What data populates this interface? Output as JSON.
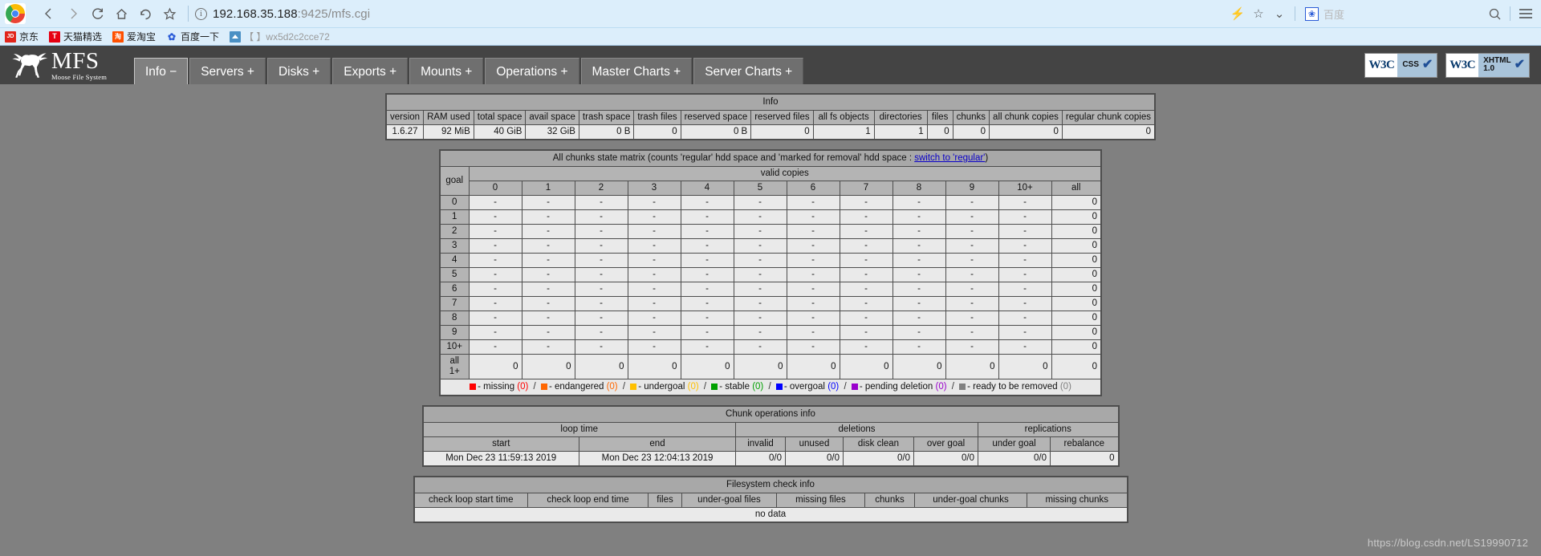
{
  "browser": {
    "url_host": "192.168.35.188",
    "url_rest": ":9425/mfs.cgi",
    "nav": {
      "back": "back-arrow",
      "forward": "forward-arrow",
      "reload": "reload",
      "home": "home",
      "history": "history-back",
      "bookmark": "star"
    },
    "right_icons": {
      "lightning": "⚡",
      "star": "☆",
      "chevron": "⌄",
      "search": "search-icon",
      "menu": "hamburger-menu"
    },
    "extension": {
      "label": "百度",
      "icon": "baidu-paw"
    },
    "bookmarks": [
      {
        "icon": "JD",
        "label": "京东",
        "type": "jd"
      },
      {
        "icon": "T",
        "label": "天猫精选",
        "type": "tm"
      },
      {
        "icon": "淘",
        "label": "爱淘宝",
        "type": "tao"
      },
      {
        "icon": "✿",
        "label": "百度一下",
        "type": "bd"
      },
      {
        "icon": "",
        "label": "【 】wx5d2c2cce72",
        "type": "home"
      }
    ]
  },
  "app": {
    "logo_main": "MFS",
    "logo_sub": "Moose File System",
    "tabs": [
      {
        "label": "Info −",
        "active": true
      },
      {
        "label": "Servers +",
        "active": false
      },
      {
        "label": "Disks +",
        "active": false
      },
      {
        "label": "Exports +",
        "active": false
      },
      {
        "label": "Mounts +",
        "active": false
      },
      {
        "label": "Operations +",
        "active": false
      },
      {
        "label": "Master Charts +",
        "active": false
      },
      {
        "label": "Server Charts +",
        "active": false
      }
    ],
    "badges": [
      {
        "brand": "W3C",
        "label": "CSS",
        "label2": ""
      },
      {
        "brand": "W3C",
        "label": "XHTML",
        "label2": "1.0"
      }
    ]
  },
  "info_table": {
    "title": "Info",
    "headers": [
      "version",
      "RAM used",
      "total space",
      "avail space",
      "trash space",
      "trash files",
      "reserved space",
      "reserved files",
      "all fs objects",
      "directories",
      "files",
      "chunks",
      "all chunk copies",
      "regular chunk copies"
    ],
    "row": [
      "1.6.27",
      "92 MiB",
      "40 GiB",
      "32 GiB",
      "0 B",
      "0",
      "0 B",
      "0",
      "1",
      "1",
      "0",
      "0",
      "0",
      "0"
    ]
  },
  "matrix": {
    "title_pre": "All chunks state matrix (counts 'regular' hdd space and 'marked for removal' hdd space : ",
    "title_link": "switch to 'regular'",
    "title_post": ")",
    "goal_label": "goal",
    "valid_copies_label": "valid copies",
    "columns": [
      "0",
      "1",
      "2",
      "3",
      "4",
      "5",
      "6",
      "7",
      "8",
      "9",
      "10+",
      "all"
    ],
    "rows": [
      {
        "goal": "0",
        "cells": [
          "-",
          "-",
          "-",
          "-",
          "-",
          "-",
          "-",
          "-",
          "-",
          "-",
          "-"
        ],
        "all": "0"
      },
      {
        "goal": "1",
        "cells": [
          "-",
          "-",
          "-",
          "-",
          "-",
          "-",
          "-",
          "-",
          "-",
          "-",
          "-"
        ],
        "all": "0"
      },
      {
        "goal": "2",
        "cells": [
          "-",
          "-",
          "-",
          "-",
          "-",
          "-",
          "-",
          "-",
          "-",
          "-",
          "-"
        ],
        "all": "0"
      },
      {
        "goal": "3",
        "cells": [
          "-",
          "-",
          "-",
          "-",
          "-",
          "-",
          "-",
          "-",
          "-",
          "-",
          "-"
        ],
        "all": "0"
      },
      {
        "goal": "4",
        "cells": [
          "-",
          "-",
          "-",
          "-",
          "-",
          "-",
          "-",
          "-",
          "-",
          "-",
          "-"
        ],
        "all": "0"
      },
      {
        "goal": "5",
        "cells": [
          "-",
          "-",
          "-",
          "-",
          "-",
          "-",
          "-",
          "-",
          "-",
          "-",
          "-"
        ],
        "all": "0"
      },
      {
        "goal": "6",
        "cells": [
          "-",
          "-",
          "-",
          "-",
          "-",
          "-",
          "-",
          "-",
          "-",
          "-",
          "-"
        ],
        "all": "0"
      },
      {
        "goal": "7",
        "cells": [
          "-",
          "-",
          "-",
          "-",
          "-",
          "-",
          "-",
          "-",
          "-",
          "-",
          "-"
        ],
        "all": "0"
      },
      {
        "goal": "8",
        "cells": [
          "-",
          "-",
          "-",
          "-",
          "-",
          "-",
          "-",
          "-",
          "-",
          "-",
          "-"
        ],
        "all": "0"
      },
      {
        "goal": "9",
        "cells": [
          "-",
          "-",
          "-",
          "-",
          "-",
          "-",
          "-",
          "-",
          "-",
          "-",
          "-"
        ],
        "all": "0"
      },
      {
        "goal": "10+",
        "cells": [
          "-",
          "-",
          "-",
          "-",
          "-",
          "-",
          "-",
          "-",
          "-",
          "-",
          "-"
        ],
        "all": "0"
      },
      {
        "goal": "all 1+",
        "cells": [
          "0",
          "0",
          "0",
          "0",
          "0",
          "0",
          "0",
          "0",
          "0",
          "0",
          "0"
        ],
        "all": "0"
      }
    ],
    "legend": [
      {
        "color": "#ff0000",
        "label": "missing",
        "count": "(0)"
      },
      {
        "color": "#ff6600",
        "label": "endangered",
        "count": "(0)"
      },
      {
        "color": "#ffc000",
        "label": "undergoal",
        "count": "(0)"
      },
      {
        "color": "#00a000",
        "label": "stable",
        "count": "(0)"
      },
      {
        "color": "#0000ff",
        "label": "overgoal",
        "count": "(0)"
      },
      {
        "color": "#9900cc",
        "label": "pending deletion",
        "count": "(0)"
      },
      {
        "color": "#808080",
        "label": "ready to be removed",
        "count": "(0)"
      }
    ],
    "legend_sep": "/"
  },
  "chunk_ops": {
    "title": "Chunk operations info",
    "group_headers": [
      "loop time",
      "deletions",
      "replications"
    ],
    "headers": [
      "start",
      "end",
      "invalid",
      "unused",
      "disk clean",
      "over goal",
      "under goal",
      "rebalance"
    ],
    "row": [
      "Mon Dec 23 11:59:13 2019",
      "Mon Dec 23 12:04:13 2019",
      "0/0",
      "0/0",
      "0/0",
      "0/0",
      "0/0",
      "0"
    ]
  },
  "fs_check": {
    "title": "Filesystem check info",
    "headers": [
      "check loop start time",
      "check loop end time",
      "files",
      "under-goal files",
      "missing files",
      "chunks",
      "under-goal chunks",
      "missing chunks"
    ],
    "no_data": "no data"
  },
  "watermark": "https://blog.csdn.net/LS19990712"
}
